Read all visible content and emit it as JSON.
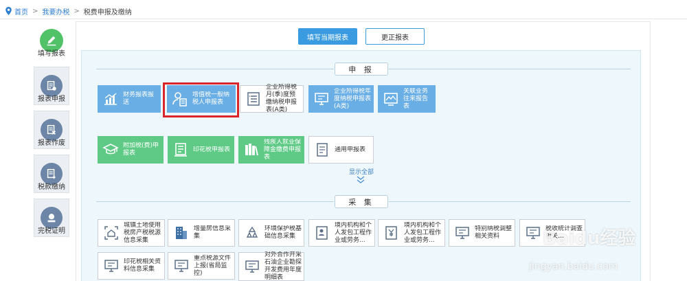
{
  "breadcrumb": {
    "home": "首页",
    "sep1": ">",
    "item2": "我要办税",
    "sep2": ">",
    "current": "税费申报及缴纳"
  },
  "nav": [
    {
      "label": "填写报表",
      "icon": "pencil-icon"
    },
    {
      "label": "报表申报",
      "icon": "report-submit-icon"
    },
    {
      "label": "报表作废",
      "icon": "report-void-icon"
    },
    {
      "label": "税款缴纳",
      "icon": "tax-payment-icon"
    },
    {
      "label": "完税证明",
      "icon": "certificate-icon"
    }
  ],
  "actions": {
    "fill_current": "填写当期报表",
    "correct": "更正报表"
  },
  "declare": {
    "title": "申 报",
    "row1": [
      {
        "label": "财务报表报送",
        "icon": "bar-chart-icon"
      },
      {
        "label": "增值税一般纳税人申报表",
        "icon": "person-doc-icon"
      },
      {
        "label": "企业所得税月(季)度预缴纳税申报表(A类)",
        "icon": "list-doc-icon"
      },
      {
        "label": "企业所得税年度纳税申报表(A类)",
        "icon": "monitor-icon"
      },
      {
        "label": "关联业务往来报告表",
        "icon": "line-chart-icon"
      }
    ],
    "row2": [
      {
        "label": "附加税(费)申报表",
        "icon": "graduation-cap-icon"
      },
      {
        "label": "印花税申报表",
        "icon": "scroll-doc-icon"
      },
      {
        "label": "残疾人就业保障金缴费申报表",
        "icon": "books-icon"
      },
      {
        "label": "通用申报表",
        "icon": "document-icon"
      }
    ],
    "show_all": "显示全部"
  },
  "collect": {
    "title": "采 集",
    "row1": [
      {
        "label": "城镇土地使用税房产税税源信息采集",
        "icon": "scan-house-icon"
      },
      {
        "label": "增量房信息采集",
        "icon": "building-icon"
      },
      {
        "label": "环境保护税基础信息采集",
        "icon": "recycle-icon"
      },
      {
        "label": "境内机构和个人发包工程作业或劳务...",
        "icon": "person-card-icon"
      },
      {
        "label": "境内机构和个人发包工程作业或劳务...",
        "icon": "yen-doc-icon"
      },
      {
        "label": "特别纳税调整相关资料",
        "icon": "monitor-icon"
      },
      {
        "label": "税收统计调查相关...",
        "icon": "monitor-icon"
      }
    ],
    "row2": [
      {
        "label": "印花税相关资料信息采集",
        "icon": "monitor-icon"
      },
      {
        "label": "重点税源文件上报(省局监控)",
        "icon": "monitor-icon"
      },
      {
        "label": "对外合作开采石油企业勘探开发费用年度明细表",
        "icon": "monitor-icon"
      }
    ]
  },
  "watermark": {
    "brand": "Baidu经验",
    "url": "jingyan.baidu.com"
  }
}
